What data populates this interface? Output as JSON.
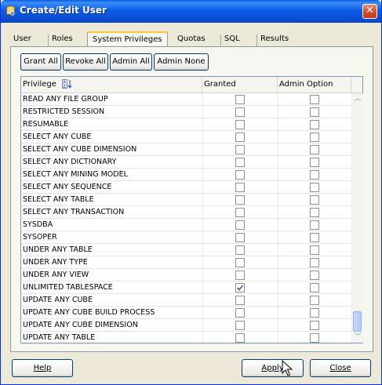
{
  "window": {
    "title": "Create/Edit User",
    "close_label": "✕"
  },
  "tabs": [
    "User",
    "Roles",
    "System Privileges",
    "Quotas",
    "SQL",
    "Results"
  ],
  "toolbar": {
    "grant_all": "Grant All",
    "revoke_all": "Revoke All",
    "admin_all": "Admin All",
    "admin_none": "Admin None"
  },
  "grid": {
    "headers": {
      "privilege": "Privilege",
      "granted": "Granted",
      "admin_option": "Admin Option"
    },
    "rows": [
      {
        "privilege": "READ ANY FILE GROUP",
        "granted": false,
        "admin": false
      },
      {
        "privilege": "RESTRICTED SESSION",
        "granted": false,
        "admin": false
      },
      {
        "privilege": "RESUMABLE",
        "granted": false,
        "admin": false
      },
      {
        "privilege": "SELECT ANY CUBE",
        "granted": false,
        "admin": false
      },
      {
        "privilege": "SELECT ANY CUBE DIMENSION",
        "granted": false,
        "admin": false
      },
      {
        "privilege": "SELECT ANY DICTIONARY",
        "granted": false,
        "admin": false
      },
      {
        "privilege": "SELECT ANY MINING MODEL",
        "granted": false,
        "admin": false
      },
      {
        "privilege": "SELECT ANY SEQUENCE",
        "granted": false,
        "admin": false
      },
      {
        "privilege": "SELECT ANY TABLE",
        "granted": false,
        "admin": false
      },
      {
        "privilege": "SELECT ANY TRANSACTION",
        "granted": false,
        "admin": false
      },
      {
        "privilege": "SYSDBA",
        "granted": false,
        "admin": false
      },
      {
        "privilege": "SYSOPER",
        "granted": false,
        "admin": false
      },
      {
        "privilege": "UNDER ANY TABLE",
        "granted": false,
        "admin": false
      },
      {
        "privilege": "UNDER ANY TYPE",
        "granted": false,
        "admin": false
      },
      {
        "privilege": "UNDER ANY VIEW",
        "granted": false,
        "admin": false
      },
      {
        "privilege": "UNLIMITED TABLESPACE",
        "granted": true,
        "admin": false
      },
      {
        "privilege": "UPDATE ANY CUBE",
        "granted": false,
        "admin": false
      },
      {
        "privilege": "UPDATE ANY CUBE BUILD PROCESS",
        "granted": false,
        "admin": false
      },
      {
        "privilege": "UPDATE ANY CUBE DIMENSION",
        "granted": false,
        "admin": false
      },
      {
        "privilege": "UPDATE ANY TABLE",
        "granted": false,
        "admin": false
      }
    ]
  },
  "footer": {
    "help": "Help",
    "apply": "Apply",
    "close": "Close"
  },
  "icons": {
    "app": "database-user-icon",
    "sort": "sort-icon",
    "check": "checkmark-icon",
    "cursor": "mouse-pointer-icon"
  },
  "colors": {
    "title_bar": "#0a5fe0",
    "dialog_bg": "#ece9d8",
    "close_button": "#d44b25",
    "check": "#2a5ca8"
  }
}
